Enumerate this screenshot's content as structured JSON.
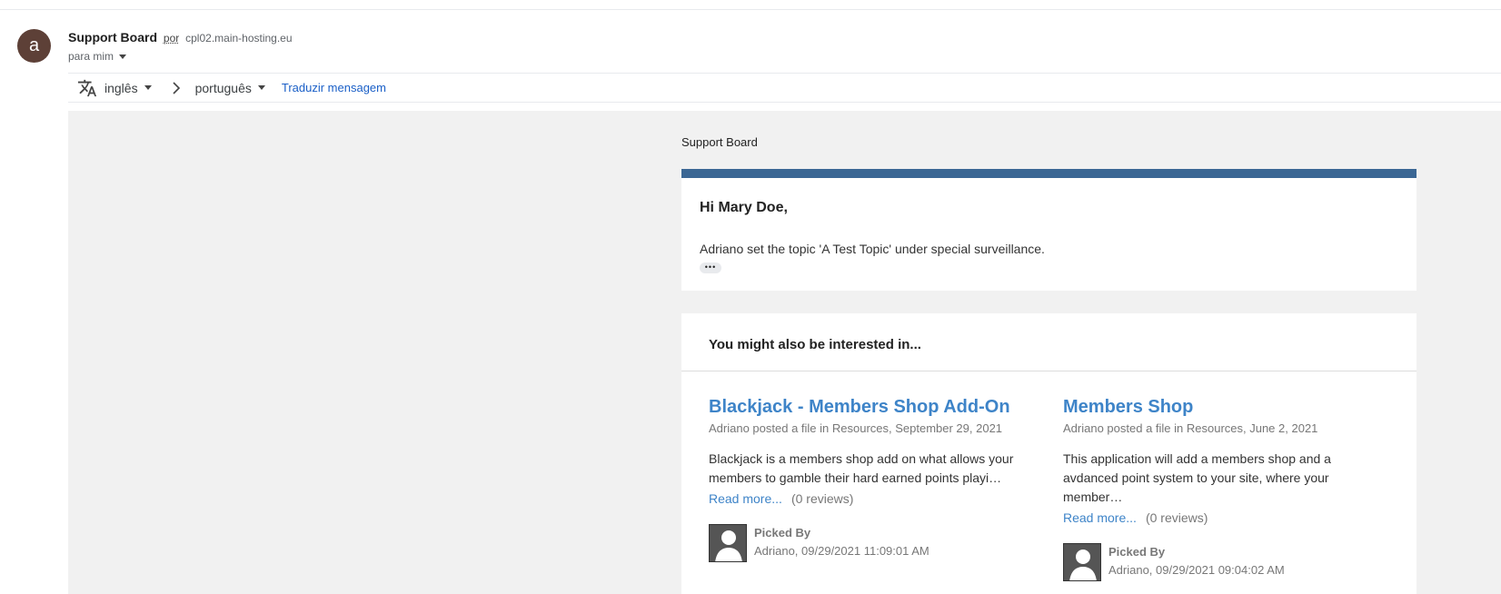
{
  "sender": {
    "avatar_letter": "a",
    "name": "Support Board",
    "via_label": "por",
    "via_domain": "cpl02.main-hosting.eu",
    "recipient": "para mim"
  },
  "translate": {
    "source_lang": "inglês",
    "target_lang": "português",
    "action": "Traduzir mensagem"
  },
  "email": {
    "brand": "Support Board",
    "greeting": "Hi Mary Doe,",
    "message": "Adriano set the topic 'A Test Topic' under special surveillance.",
    "ellipsis": "•••",
    "accent_color": "#3b6794",
    "related": {
      "title": "You might also be interested in...",
      "items": [
        {
          "title": "Blackjack - Members Shop Add-On",
          "meta": "Adriano posted a file in Resources, September 29, 2021",
          "description": "Blackjack is a members shop add on what allows your members to gamble their hard earned points playi…",
          "read_more": "Read more...",
          "reviews": "(0 reviews)",
          "picked_label": "Picked By",
          "picked_detail": "Adriano, 09/29/2021 11:09:01 AM"
        },
        {
          "title": "Members Shop",
          "meta": "Adriano posted a file in Resources, June 2, 2021",
          "description": "This application will add a members shop and a avdanced point system to your site, where your member…",
          "read_more": "Read more...",
          "reviews": "(0 reviews)",
          "picked_label": "Picked By",
          "picked_detail": "Adriano, 09/29/2021 09:04:02 AM"
        }
      ]
    }
  }
}
